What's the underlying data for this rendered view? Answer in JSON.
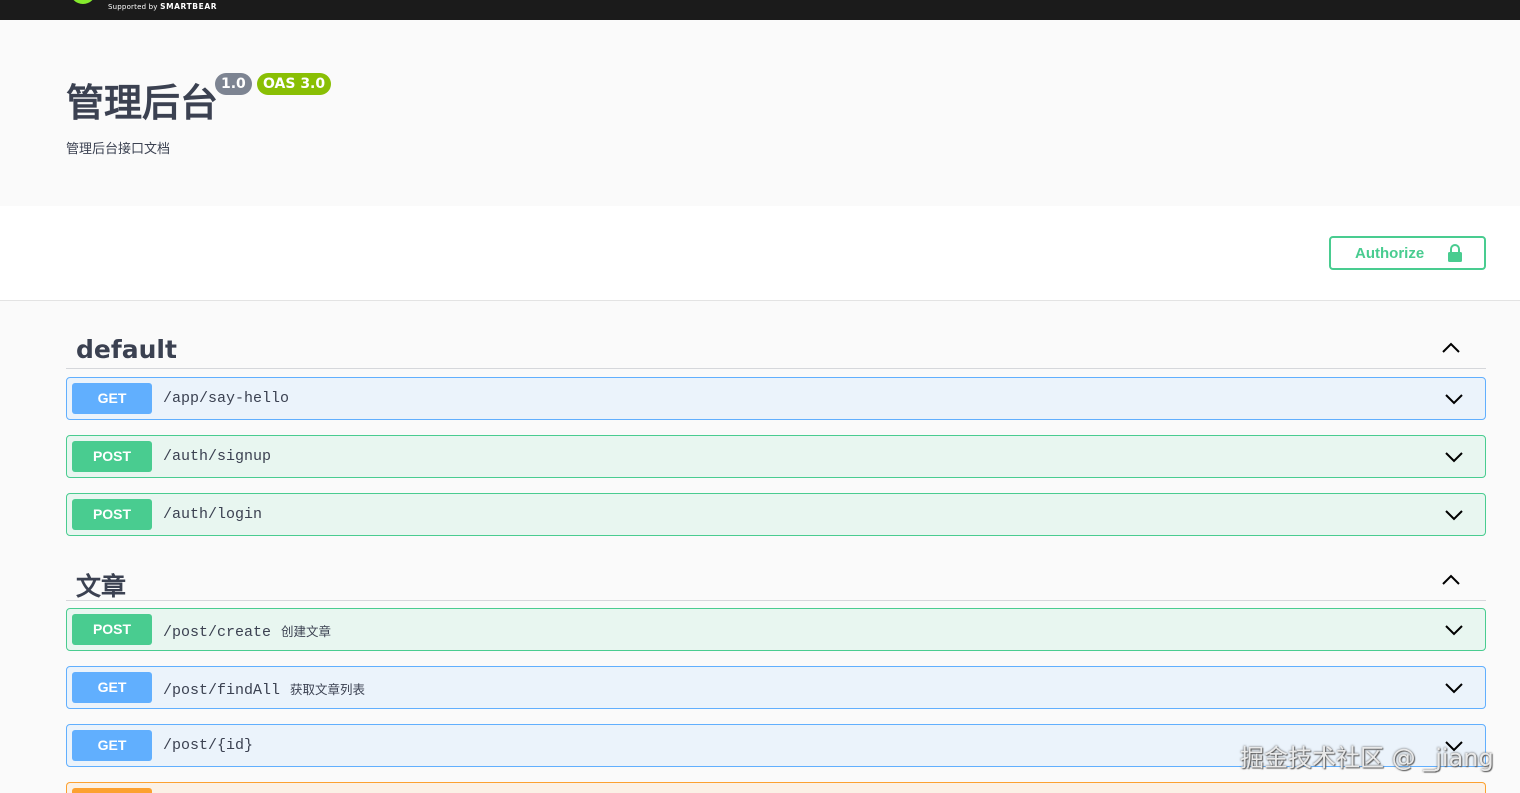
{
  "topbar": {
    "supported_prefix": "Supported by",
    "supported_brand": "SMARTBEAR"
  },
  "info": {
    "title": "管理后台",
    "version": "1.0",
    "oas": "OAS 3.0",
    "description": "管理后台接口文档"
  },
  "authorize": {
    "label": "Authorize",
    "icon": "lock-icon"
  },
  "colors": {
    "get": "#61affe",
    "post": "#49cc90",
    "put": "#fca130",
    "text": "#3b4151"
  },
  "sections": [
    {
      "name": "default",
      "operations": [
        {
          "method": "GET",
          "path": "/app/say-hello",
          "summary": ""
        },
        {
          "method": "POST",
          "path": "/auth/signup",
          "summary": ""
        },
        {
          "method": "POST",
          "path": "/auth/login",
          "summary": ""
        }
      ]
    },
    {
      "name": "文章",
      "operations": [
        {
          "method": "POST",
          "path": "/post/create",
          "summary": "创建文章"
        },
        {
          "method": "GET",
          "path": "/post/findAll",
          "summary": "获取文章列表"
        },
        {
          "method": "GET",
          "path": "/post/{id}",
          "summary": ""
        }
      ]
    }
  ],
  "watermark": "掘金技术社区 @ _jiang"
}
